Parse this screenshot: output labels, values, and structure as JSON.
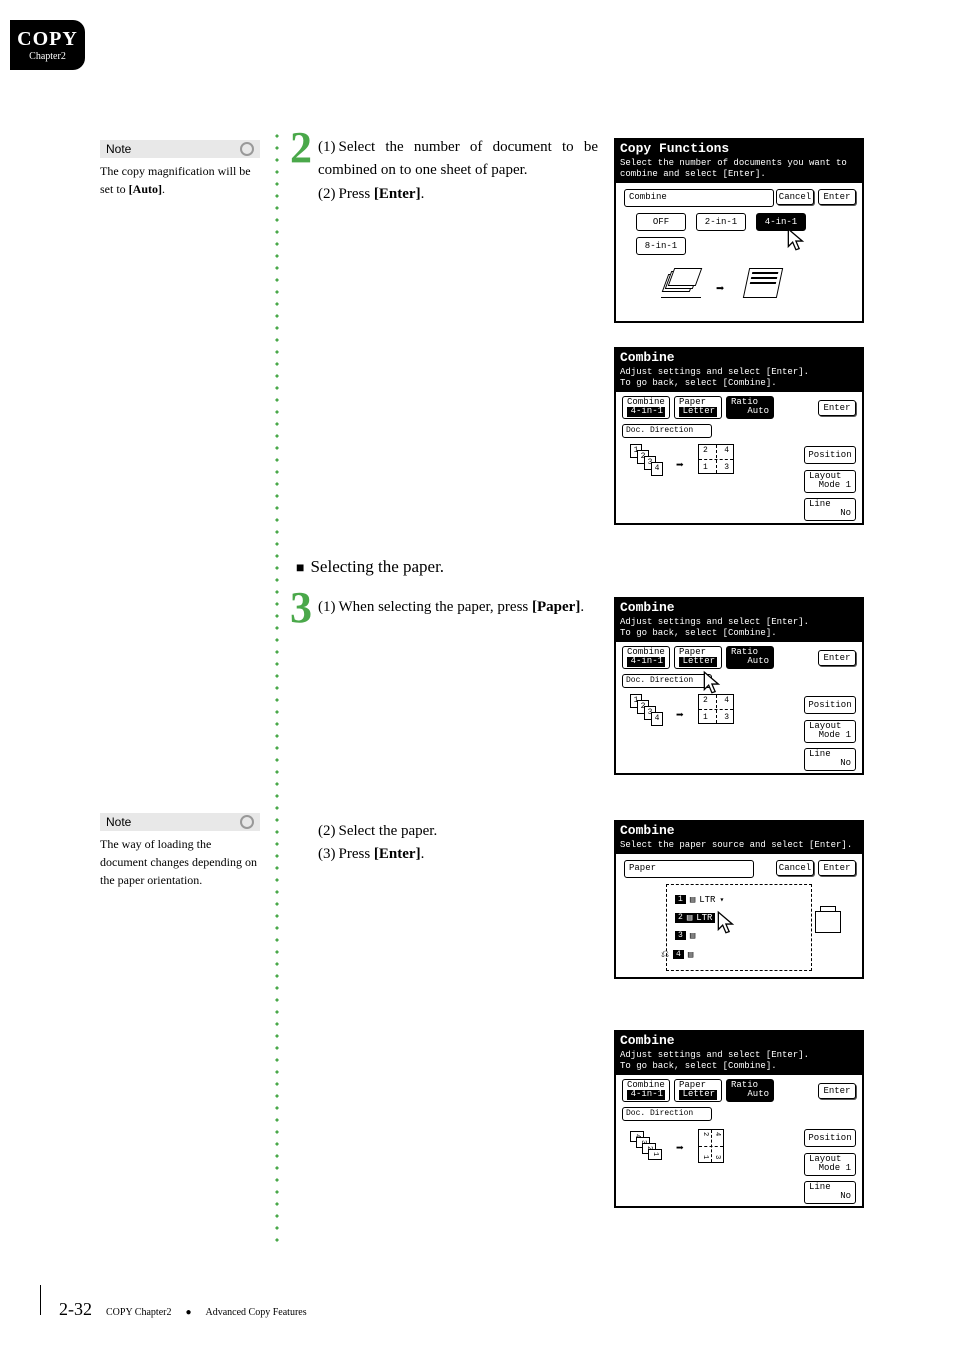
{
  "header": {
    "title": "COPY",
    "subtitle": "Chapter2"
  },
  "notes": {
    "n1": {
      "label": "Note",
      "text_a": "The copy magnification will be set to ",
      "text_b": "[Auto]",
      "text_c": "."
    },
    "n2": {
      "label": "Note",
      "text": "The way of loading the document changes depending on the paper orientation."
    }
  },
  "steps": {
    "s2": {
      "num": "2",
      "l1a": "(1)",
      "l1b": "Select the number of document to be combined on to one sheet of paper.",
      "l2a": "(2)",
      "l2b": "Press ",
      "l2c": "[Enter]",
      "l2d": "."
    },
    "sec_paper": {
      "sq": "■",
      "text": "Selecting the paper."
    },
    "s3": {
      "num": "3",
      "l1a": "(1)",
      "l1b": "When selecting the paper, press ",
      "l1c": "[Paper]",
      "l1d": ".",
      "l2a": "(2)",
      "l2b": "Select the paper.",
      "l3a": "(3)",
      "l3b": "Press ",
      "l3c": "[Enter]",
      "l3d": "."
    }
  },
  "screens": {
    "a": {
      "title": "Copy Functions",
      "sub": "Select the number of documents you want to combine and select [Enter].",
      "combine": "Combine",
      "cancel": "Cancel",
      "enter": "Enter",
      "off": "OFF",
      "b2": "2-in-1",
      "b4": "4-in-1",
      "b8": "8-in-1"
    },
    "b": {
      "title": "Combine",
      "sub1": "Adjust settings and select [Enter].",
      "sub2": "To go back, select [Combine].",
      "combine": "Combine",
      "combine_v": "4-in-1",
      "paper": "Paper",
      "paper_v": "Letter",
      "ratio": "Ratio",
      "ratio_v": "Auto",
      "enter": "Enter",
      "docdir": "Doc. Direction",
      "position": "Position",
      "layout": "Layout",
      "layout_v": "Mode 1",
      "line": "Line",
      "line_v": "No"
    },
    "d": {
      "title": "Combine",
      "sub": "Select the paper source and select [Enter].",
      "paper": "Paper",
      "cancel": "Cancel",
      "enter": "Enter",
      "t1": "LTR",
      "t2": "LTR"
    }
  },
  "footer": {
    "page": "2-32",
    "chapter": "COPY Chapter2",
    "bullet": "●",
    "section": "Advanced Copy Features"
  }
}
